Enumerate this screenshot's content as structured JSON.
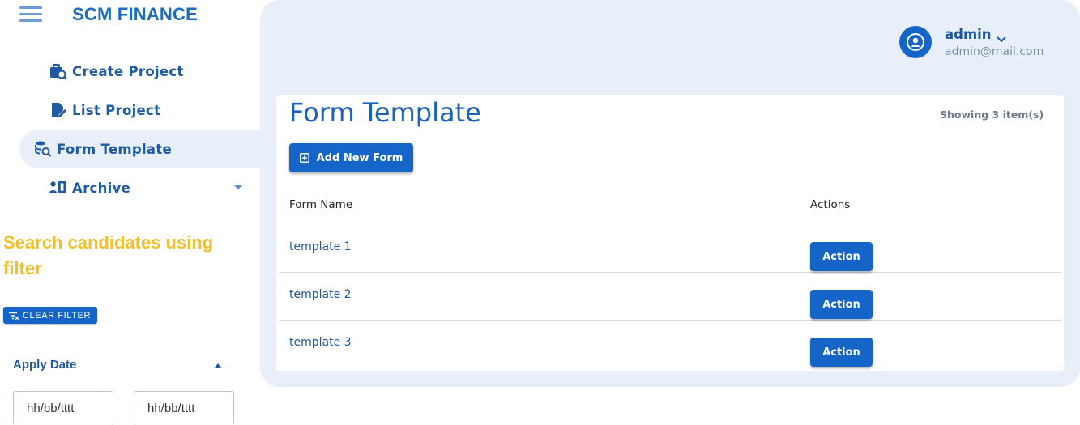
{
  "brand": "SCM FINANCE",
  "nav": {
    "create_project": "Create Project",
    "list_project": "List Project",
    "form_template": "Form Template",
    "archive": "Archive"
  },
  "filter": {
    "title": "Search candidates using filter",
    "clear_label": "CLEAR FILTER",
    "apply_date_label": "Apply Date",
    "date_from_placeholder": "hh/bb/tttt",
    "date_to_placeholder": "hh/bb/tttt"
  },
  "user": {
    "name": "admin",
    "email": "admin@mail.com"
  },
  "page": {
    "title": "Form Template",
    "showing": "Showing 3 item(s)",
    "add_button": "Add New Form"
  },
  "table": {
    "columns": [
      "Form Name",
      "Actions"
    ],
    "rows": [
      {
        "name": "template 1",
        "action": "Action"
      },
      {
        "name": "template 2",
        "action": "Action"
      },
      {
        "name": "template 3",
        "action": "Action"
      }
    ]
  },
  "colors": {
    "primary": "#1565c8",
    "panel_bg": "#e8eff8",
    "accent_yellow": "#f2bf2a"
  }
}
